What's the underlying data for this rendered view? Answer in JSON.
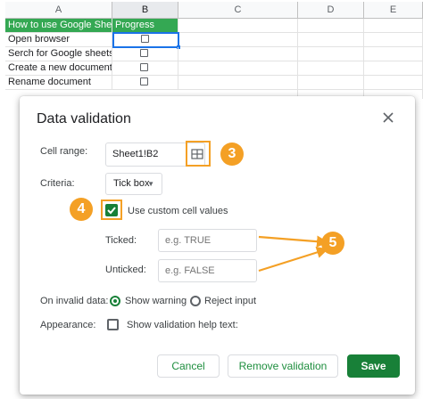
{
  "sheet": {
    "columns": [
      "A",
      "B",
      "C",
      "D",
      "E"
    ],
    "rows": [
      {
        "a": "How to use Google Sheets",
        "b": "Progress"
      },
      {
        "a": "Open browser"
      },
      {
        "a": "Serch for Google sheets"
      },
      {
        "a": "Create a new document"
      },
      {
        "a": "Rename document"
      }
    ]
  },
  "dialog": {
    "title": "Data validation",
    "cell_range_label": "Cell range:",
    "cell_range_value": "Sheet1!B2",
    "criteria_label": "Criteria:",
    "criteria_value": "Tick box",
    "custom_values_label": "Use custom cell values",
    "custom_values_checked": true,
    "ticked_label": "Ticked:",
    "ticked_placeholder": "e.g. TRUE",
    "unticked_label": "Unticked:",
    "unticked_placeholder": "e.g. FALSE",
    "invalid_label": "On invalid data:",
    "show_warning_label": "Show warning",
    "reject_input_label": "Reject input",
    "selected_invalid_option": "Show warning",
    "appearance_label": "Appearance:",
    "help_text_label": "Show validation help text:",
    "help_text_checked": false,
    "cancel_label": "Cancel",
    "remove_label": "Remove validation",
    "save_label": "Save"
  },
  "annotations": {
    "badge_3": "3",
    "badge_4": "4",
    "badge_5": "5"
  },
  "colors": {
    "header_green": "#34a853",
    "accent_green": "#188038",
    "annotation_orange": "#f4a025",
    "selection_blue": "#1a73e8"
  },
  "icons": [
    "grid-select-icon",
    "close-icon",
    "dropdown-caret-icon",
    "checkmark-icon",
    "arrow-icon"
  ]
}
